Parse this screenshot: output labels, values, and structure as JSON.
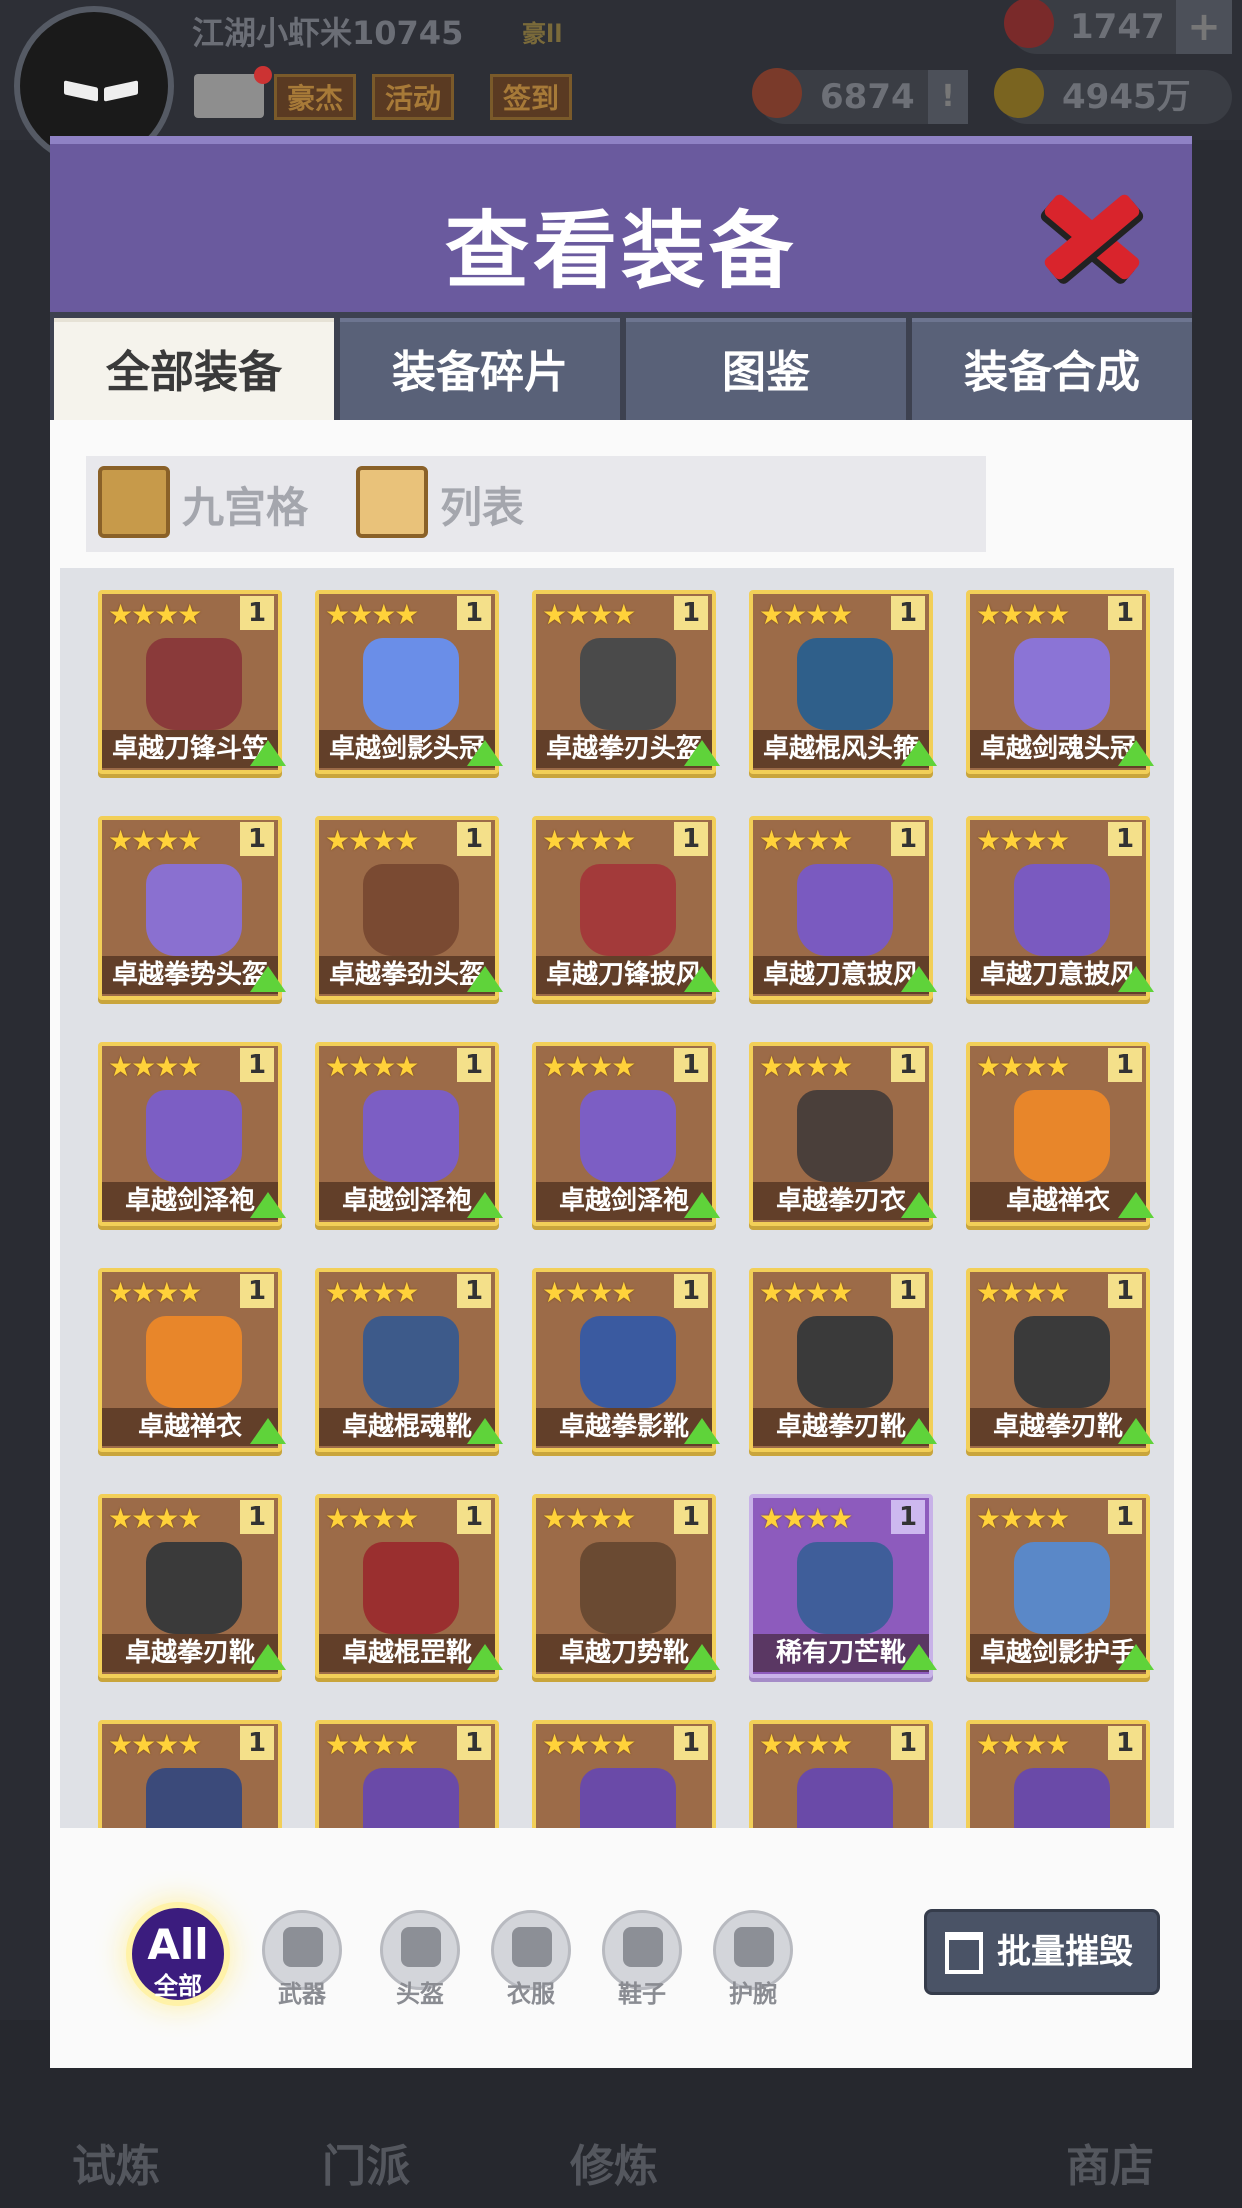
{
  "hud": {
    "player_name": "江湖小虾米10745",
    "rank": "豪ll",
    "buttons": [
      "豪杰",
      "活动",
      "签到"
    ],
    "gems": "1747",
    "honor": "6874",
    "gold": "4945万"
  },
  "dialog": {
    "title": "查看装备",
    "tabs": [
      "全部装备",
      "装备碎片",
      "图鉴",
      "装备合成"
    ],
    "view_modes": [
      "九宫格",
      "列表"
    ],
    "items": [
      {
        "name": "卓越刀锋斗笠",
        "stars": "★★★★",
        "count": "1",
        "color": "#8a3a3a"
      },
      {
        "name": "卓越剑影头冠",
        "stars": "★★★★",
        "count": "1",
        "color": "#6a8ee8"
      },
      {
        "name": "卓越拳刃头盔",
        "stars": "★★★★",
        "count": "1",
        "color": "#4a4a4a"
      },
      {
        "name": "卓越棍风头箍",
        "stars": "★★★★",
        "count": "1",
        "color": "#2f5f8a"
      },
      {
        "name": "卓越剑魂头冠",
        "stars": "★★★★",
        "count": "1",
        "color": "#8b74d6"
      },
      {
        "name": "卓越拳势头盔",
        "stars": "★★★★",
        "count": "1",
        "color": "#8a70d0"
      },
      {
        "name": "卓越拳劲头盔",
        "stars": "★★★★",
        "count": "1",
        "color": "#7a4a32"
      },
      {
        "name": "卓越刀锋披风",
        "stars": "★★★★",
        "count": "1",
        "color": "#a33a3a"
      },
      {
        "name": "卓越刀意披风",
        "stars": "★★★★",
        "count": "1",
        "color": "#7a5ac0"
      },
      {
        "name": "卓越刀意披风",
        "stars": "★★★★",
        "count": "1",
        "color": "#7a5ac0"
      },
      {
        "name": "卓越剑泽袍",
        "stars": "★★★★",
        "count": "1",
        "color": "#7c5ec4"
      },
      {
        "name": "卓越剑泽袍",
        "stars": "★★★★",
        "count": "1",
        "color": "#7c5ec4"
      },
      {
        "name": "卓越剑泽袍",
        "stars": "★★★★",
        "count": "1",
        "color": "#7c5ec4"
      },
      {
        "name": "卓越拳刃衣",
        "stars": "★★★★",
        "count": "1",
        "color": "#4a3f3a"
      },
      {
        "name": "卓越禅衣",
        "stars": "★★★★",
        "count": "1",
        "color": "#e8862a"
      },
      {
        "name": "卓越禅衣",
        "stars": "★★★★",
        "count": "1",
        "color": "#e8862a"
      },
      {
        "name": "卓越棍魂靴",
        "stars": "★★★★",
        "count": "1",
        "color": "#3d5a8a"
      },
      {
        "name": "卓越拳影靴",
        "stars": "★★★★",
        "count": "1",
        "color": "#3a5aa0"
      },
      {
        "name": "卓越拳刃靴",
        "stars": "★★★★",
        "count": "1",
        "color": "#3a3a3a"
      },
      {
        "name": "卓越拳刃靴",
        "stars": "★★★★",
        "count": "1",
        "color": "#3a3a3a"
      },
      {
        "name": "卓越拳刃靴",
        "stars": "★★★★",
        "count": "1",
        "color": "#3a3a3a"
      },
      {
        "name": "卓越棍罡靴",
        "stars": "★★★★",
        "count": "1",
        "color": "#9a2f2f"
      },
      {
        "name": "卓越刀势靴",
        "stars": "★★★★",
        "count": "1",
        "color": "#6a4a32"
      },
      {
        "name": "稀有刀芒靴",
        "stars": "★★★★",
        "count": "1",
        "color": "#3f5e9a",
        "rare": true
      },
      {
        "name": "卓越剑影护手",
        "stars": "★★★★",
        "count": "1",
        "color": "#5a88c8"
      },
      {
        "name": "",
        "stars": "★★★★",
        "count": "1",
        "color": "#3b4a7a"
      },
      {
        "name": "",
        "stars": "★★★★",
        "count": "1",
        "color": "#6a4aa8"
      },
      {
        "name": "",
        "stars": "★★★★",
        "count": "1",
        "color": "#6a4aa8"
      },
      {
        "name": "",
        "stars": "★★★★",
        "count": "1",
        "color": "#6a4aa8"
      },
      {
        "name": "",
        "stars": "★★★★",
        "count": "1",
        "color": "#6a4aa8"
      }
    ],
    "filters": {
      "all_main": "All",
      "all_sub": "全部",
      "labels": [
        "武器",
        "头盔",
        "衣服",
        "鞋子",
        "护腕"
      ]
    },
    "batch_button": "批量摧毁"
  },
  "bottom_nav": [
    "试炼",
    "门派",
    "修炼",
    "商店"
  ]
}
